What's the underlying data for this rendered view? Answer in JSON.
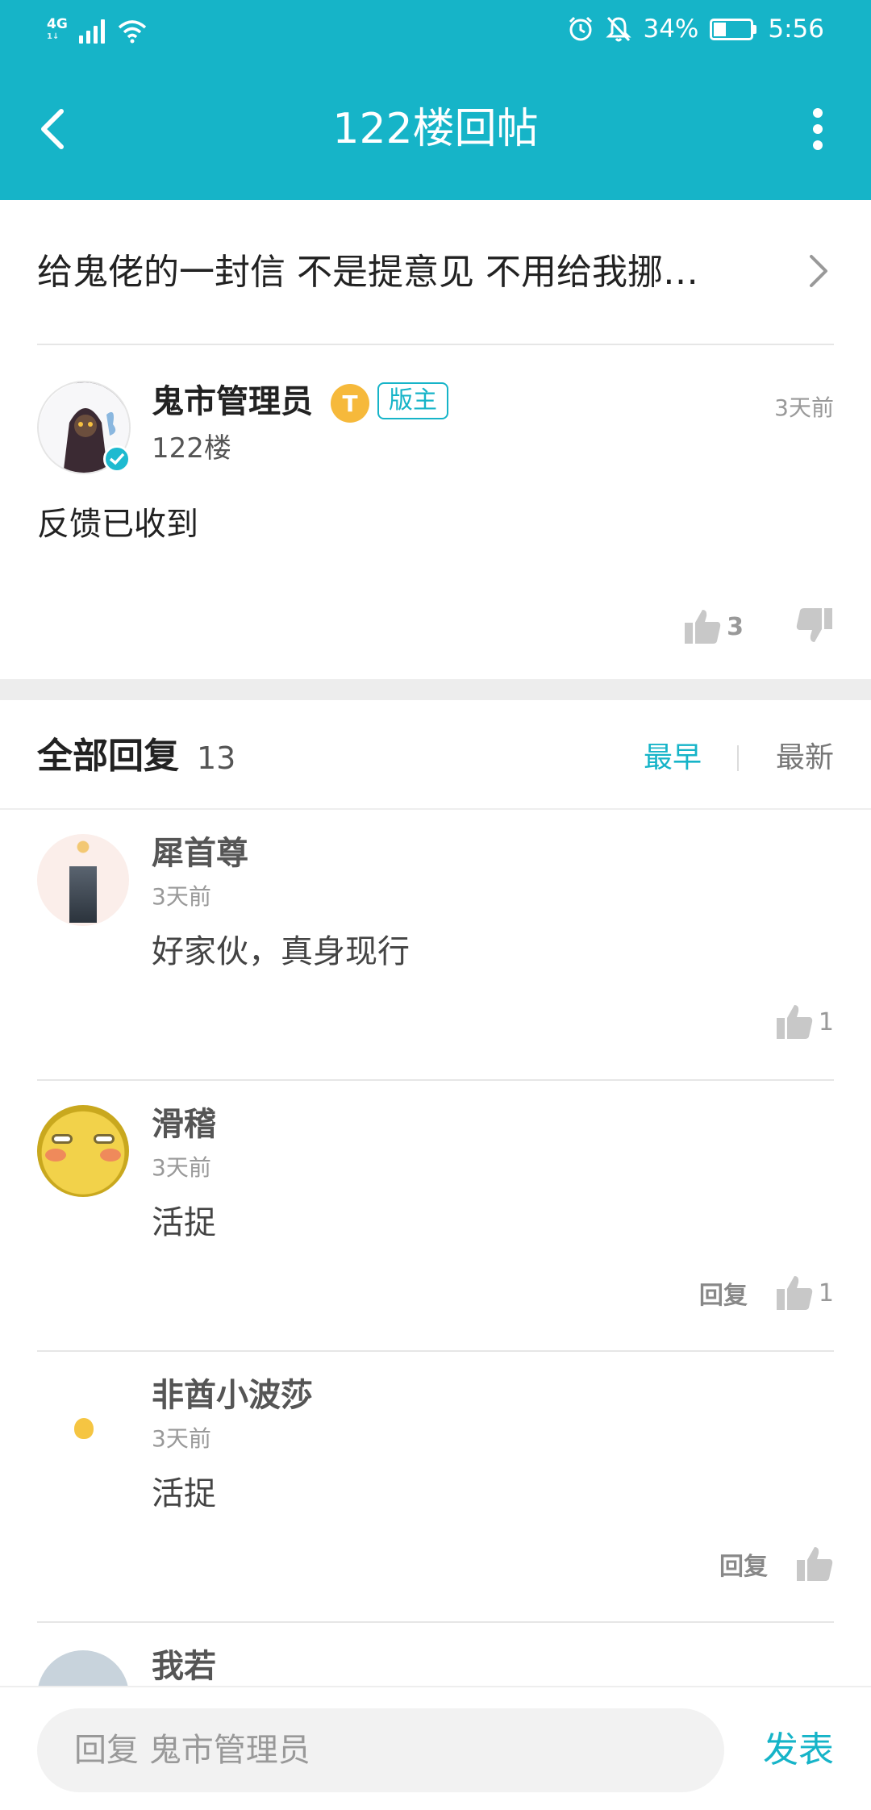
{
  "status_bar": {
    "network": "4G",
    "network_sub": "1↓",
    "battery_percent": "34%",
    "battery_level": 0.34,
    "time": "5:56"
  },
  "toolbar": {
    "title": "122楼回帖"
  },
  "thread": {
    "title": "给鬼佬的一封信 不是提意见 不用给我挪…"
  },
  "post": {
    "author": "鬼市管理员",
    "level_badge": "T",
    "role_badge": "版主",
    "floor": "122楼",
    "time": "3天前",
    "content": "反馈已收到",
    "like_count": "3"
  },
  "replies_header": {
    "title": "全部回复",
    "count": "13",
    "sort_earliest": "最早",
    "sort_latest": "最新"
  },
  "replies": [
    {
      "name": "犀首尊",
      "time": "3天前",
      "content": "好家伙，真身现行",
      "likes": "1"
    },
    {
      "name": "滑稽",
      "time": "3天前",
      "content": "活捉",
      "reply_label": "回复",
      "likes": "1"
    },
    {
      "name": "非酋小波莎",
      "time": "3天前",
      "content": "活捉",
      "reply_label": "回复",
      "likes": ""
    },
    {
      "name": "我若"
    }
  ],
  "input": {
    "placeholder": "回复 鬼市管理员",
    "send_label": "发表"
  },
  "colors": {
    "accent": "#16b4c8",
    "background": "#ffffff",
    "divider": "#ededed"
  }
}
